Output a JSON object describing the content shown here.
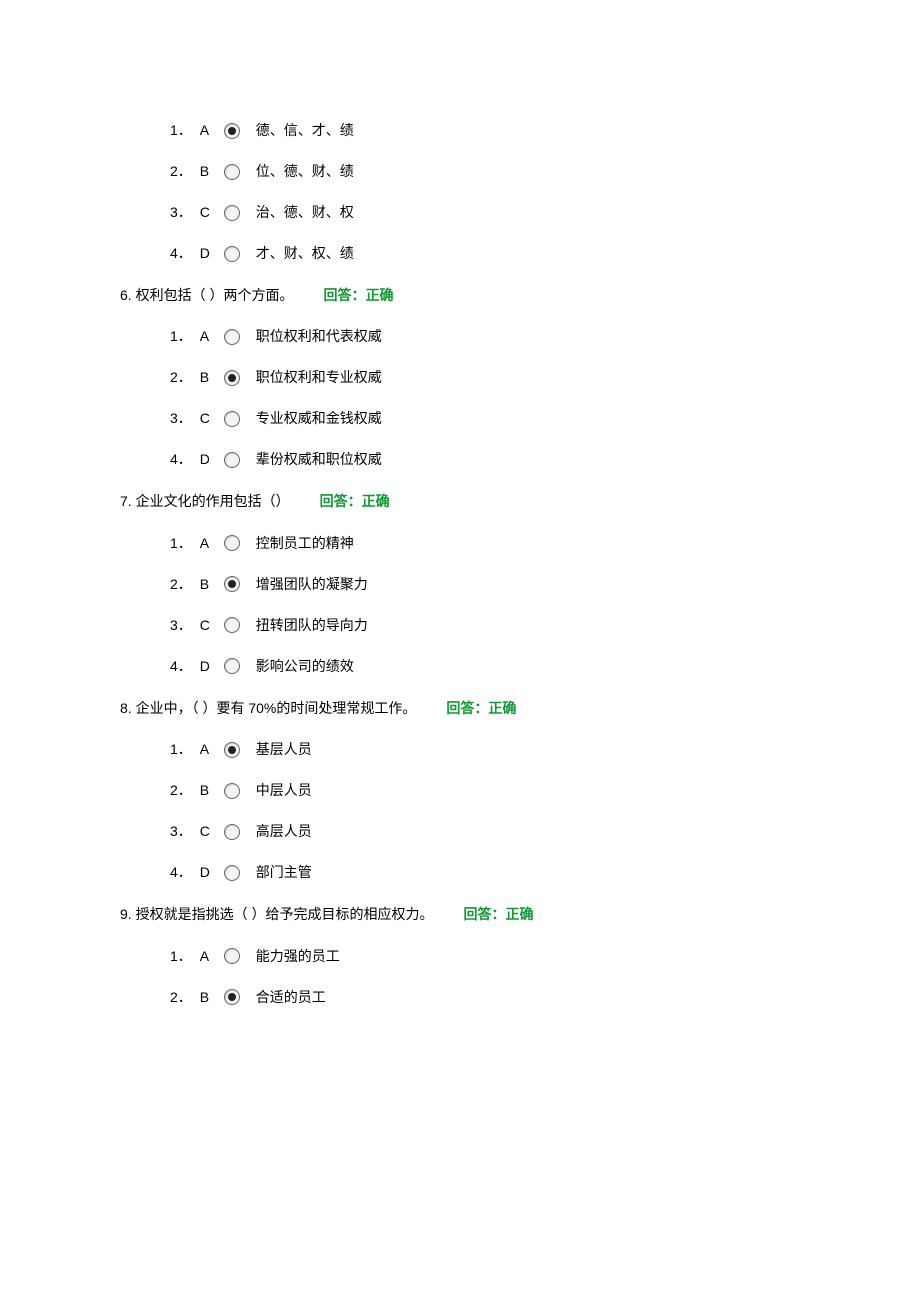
{
  "blocks": [
    {
      "options": [
        {
          "num": "1．",
          "letter": "A",
          "checked": true,
          "text": "德、信、才、绩"
        },
        {
          "num": "2．",
          "letter": "B",
          "checked": false,
          "text": "位、德、财、绩"
        },
        {
          "num": "3．",
          "letter": "C",
          "checked": false,
          "text": "治、德、财、权"
        },
        {
          "num": "4．",
          "letter": "D",
          "checked": false,
          "text": "才、财、权、绩"
        }
      ]
    },
    {
      "question": {
        "num": "6.",
        "text": "权利包括（ ）两个方面。",
        "feedback": "回答：正确"
      },
      "options": [
        {
          "num": "1．",
          "letter": "A",
          "checked": false,
          "text": "职位权利和代表权威"
        },
        {
          "num": "2．",
          "letter": "B",
          "checked": true,
          "text": "职位权利和专业权威"
        },
        {
          "num": "3．",
          "letter": "C",
          "checked": false,
          "text": "专业权威和金钱权威"
        },
        {
          "num": "4．",
          "letter": "D",
          "checked": false,
          "text": "辈份权威和职位权威"
        }
      ]
    },
    {
      "question": {
        "num": "7.",
        "text": "企业文化的作用包括（）",
        "feedback": "回答：正确"
      },
      "options": [
        {
          "num": "1．",
          "letter": "A",
          "checked": false,
          "text": "控制员工的精神"
        },
        {
          "num": "2．",
          "letter": "B",
          "checked": true,
          "text": "增强团队的凝聚力"
        },
        {
          "num": "3．",
          "letter": "C",
          "checked": false,
          "text": "扭转团队的导向力"
        },
        {
          "num": "4．",
          "letter": "D",
          "checked": false,
          "text": "影响公司的绩效"
        }
      ]
    },
    {
      "question": {
        "num": "8.",
        "text": "企业中，（ ）要有 70%的时间处理常规工作。",
        "feedback": "回答：正确"
      },
      "options": [
        {
          "num": "1．",
          "letter": "A",
          "checked": true,
          "text": "基层人员"
        },
        {
          "num": "2．",
          "letter": "B",
          "checked": false,
          "text": "中层人员"
        },
        {
          "num": "3．",
          "letter": "C",
          "checked": false,
          "text": "高层人员"
        },
        {
          "num": "4．",
          "letter": "D",
          "checked": false,
          "text": "部门主管"
        }
      ]
    },
    {
      "question": {
        "num": "9.",
        "text": "授权就是指挑选（ ）给予完成目标的相应权力。",
        "feedback": "回答：正确"
      },
      "options": [
        {
          "num": "1．",
          "letter": "A",
          "checked": false,
          "text": "能力强的员工"
        },
        {
          "num": "2．",
          "letter": "B",
          "checked": true,
          "text": "合适的员工"
        }
      ]
    }
  ]
}
